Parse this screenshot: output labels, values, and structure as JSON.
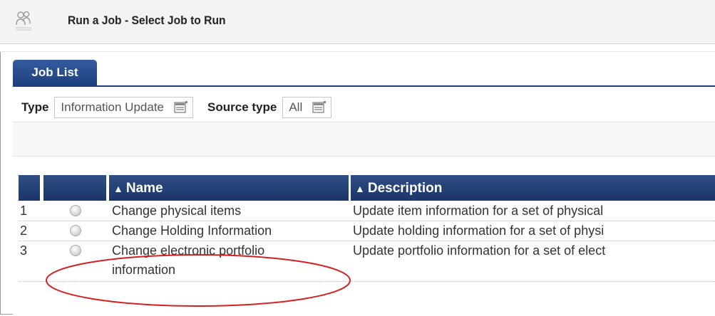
{
  "header": {
    "title": "Run a Job - Select Job to Run",
    "icon": "people-icon"
  },
  "tabs": [
    {
      "label": "Job List",
      "active": true
    }
  ],
  "filters": {
    "type_label": "Type",
    "type_value": "Information Update",
    "source_label": "Source type",
    "source_value": "All"
  },
  "table": {
    "columns": [
      "",
      "",
      "Name",
      "Description"
    ],
    "rows": [
      {
        "num": "1",
        "name": "Change physical items",
        "name2": "",
        "desc": "Update item information for a set of physical"
      },
      {
        "num": "2",
        "name": "Change Holding Information",
        "name2": "",
        "desc": "Update holding information for a set of physi"
      },
      {
        "num": "3",
        "name": "Change electronic portfolio",
        "name2": "information",
        "desc": "Update portfolio information for a set of elect"
      }
    ]
  },
  "colors": {
    "header_bg": "#f3f3f3",
    "accent": "#1f3e7c",
    "annotation": "#d62020"
  }
}
